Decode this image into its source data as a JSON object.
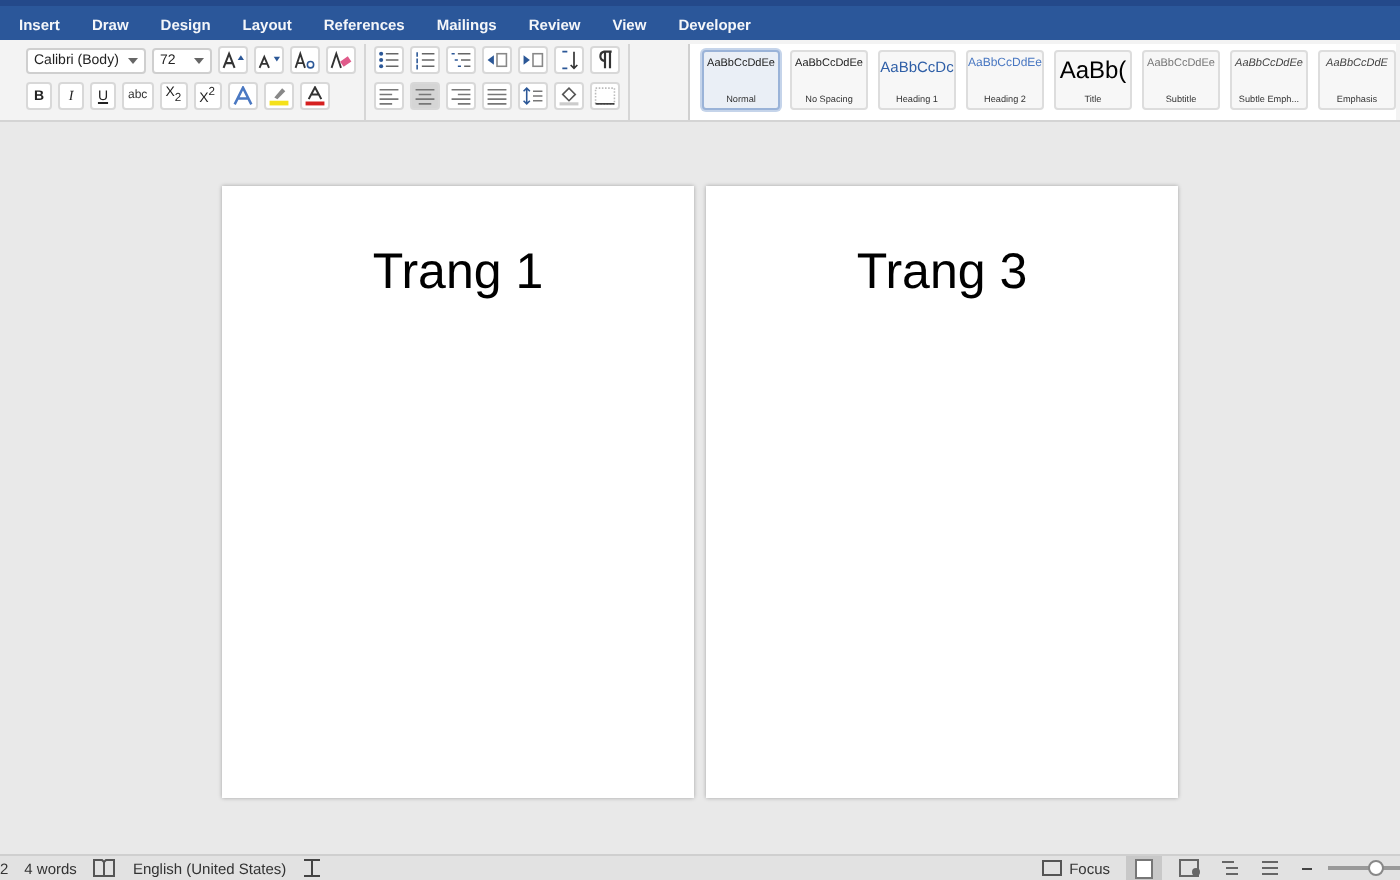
{
  "tabs": [
    {
      "label": "Insert"
    },
    {
      "label": "Draw"
    },
    {
      "label": "Design"
    },
    {
      "label": "Layout"
    },
    {
      "label": "References"
    },
    {
      "label": "Mailings"
    },
    {
      "label": "Review"
    },
    {
      "label": "View"
    },
    {
      "label": "Developer"
    }
  ],
  "font": {
    "family": "Calibri (Body)",
    "size": "72"
  },
  "format_buttons": [
    {
      "label": "B",
      "kind": "bold"
    },
    {
      "label": "I",
      "kind": "italic"
    },
    {
      "label": "U",
      "kind": "underline"
    },
    {
      "label": "abc",
      "kind": "strike"
    },
    {
      "label": "X$_{2}$",
      "kind": "plain"
    },
    {
      "label": "X$^{2}$",
      "kind": "plain"
    }
  ],
  "styles": [
    {
      "sample": "AaBbCcDdEe",
      "name": "Normal",
      "kind": "normal",
      "selected": true
    },
    {
      "sample": "AaBbCcDdEe",
      "name": "No Spacing",
      "kind": "normal",
      "selected": false
    },
    {
      "sample": "AaBbCcDc",
      "name": "Heading 1",
      "kind": "heading1",
      "selected": false
    },
    {
      "sample": "AaBbCcDdEe",
      "name": "Heading 2",
      "kind": "heading2",
      "selected": false
    },
    {
      "sample": "AaBb(",
      "name": "Title",
      "kind": "title",
      "selected": false
    },
    {
      "sample": "AaBbCcDdEe",
      "name": "Subtitle",
      "kind": "subtitle",
      "selected": false
    },
    {
      "sample": "AaBbCcDdEe",
      "name": "Subtle Emph...",
      "kind": "emphasis",
      "selected": false
    },
    {
      "sample": "AaBbCcDdE",
      "name": "Emphasis",
      "kind": "emphasis",
      "selected": false
    }
  ],
  "pages": [
    {
      "text": "Trang 1"
    },
    {
      "text": "Trang 3"
    }
  ],
  "status_bar": {
    "page": "2",
    "words": "4 words",
    "language": "English (United States)",
    "focus": "Focus",
    "zoom": {
      "level": 0.6
    }
  }
}
